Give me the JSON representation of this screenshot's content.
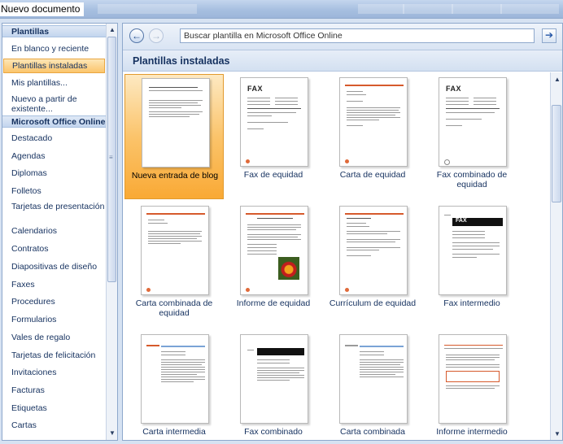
{
  "window": {
    "title": "Nuevo documento"
  },
  "sidebar": {
    "header_templates": "Plantillas",
    "items_top": [
      {
        "label": "En blanco y reciente"
      },
      {
        "label": "Plantillas instaladas",
        "selected": true
      },
      {
        "label": "Mis plantillas..."
      },
      {
        "label": "Nuevo a partir de existente..."
      }
    ],
    "header_online": "Microsoft Office Online",
    "items_online": [
      {
        "label": "Destacado"
      },
      {
        "label": "Agendas"
      },
      {
        "label": "Diplomas"
      },
      {
        "label": "Folletos"
      },
      {
        "label": "Tarjetas de presentación"
      },
      {
        "label": "Calendarios"
      },
      {
        "label": "Contratos"
      },
      {
        "label": "Diapositivas de diseño"
      },
      {
        "label": "Faxes"
      },
      {
        "label": "Procedures"
      },
      {
        "label": "Formularios"
      },
      {
        "label": "Vales de regalo"
      },
      {
        "label": "Tarjetas de felicitación"
      },
      {
        "label": "Invitaciones"
      },
      {
        "label": "Facturas"
      },
      {
        "label": "Etiquetas"
      },
      {
        "label": "Cartas"
      }
    ]
  },
  "toolbar": {
    "search_placeholder": "Buscar plantilla en Microsoft Office Online",
    "back_icon": "back-arrow-icon",
    "forward_icon": "forward-arrow-icon",
    "go_icon": "go-arrow-icon"
  },
  "main": {
    "section_title": "Plantillas instaladas",
    "templates": [
      {
        "label": "Nueva entrada de blog",
        "selected": true,
        "style": "blog"
      },
      {
        "label": "Fax de equidad",
        "style": "fax"
      },
      {
        "label": "Carta de equidad",
        "style": "letter-red"
      },
      {
        "label": "Fax combinado de equidad",
        "style": "fax"
      },
      {
        "label": "Carta combinada de equidad",
        "style": "letter-red"
      },
      {
        "label": "Informe de equidad",
        "style": "report"
      },
      {
        "label": "Currículum de equidad",
        "style": "resume"
      },
      {
        "label": "Fax intermedio",
        "style": "fax-dark"
      },
      {
        "label": "Carta intermedia",
        "style": "letter-mid"
      },
      {
        "label": "Fax combinado",
        "style": "fax-dark2"
      },
      {
        "label": "Carta combinada",
        "style": "letter-mid2"
      },
      {
        "label": "Informe intermedio",
        "style": "report-mid"
      }
    ]
  },
  "colors": {
    "accent_selected": "#fbc56c",
    "link_text": "#15315f",
    "equity_red": "#d65a2c"
  }
}
